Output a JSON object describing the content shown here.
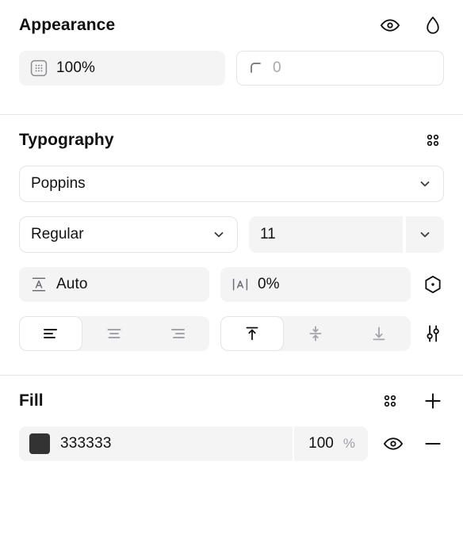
{
  "appearance": {
    "title": "Appearance",
    "header_icons": [
      {
        "name": "visibility-eye-icon",
        "label": "Toggle visibility"
      },
      {
        "name": "blend-mode-droplet-icon",
        "label": "Blend mode"
      }
    ],
    "opacity": {
      "icon": "opacity-grid-icon",
      "value": "100%"
    },
    "corner_radius": {
      "icon": "corner-radius-icon",
      "value": "0",
      "placeholder": "0"
    }
  },
  "typography": {
    "title": "Typography",
    "header_icons": [
      {
        "name": "text-styles-dots-icon",
        "label": "Text styles"
      }
    ],
    "font_family": {
      "value": "Poppins",
      "chevron": "chevron-down-icon"
    },
    "font_weight": {
      "value": "Regular",
      "chevron": "chevron-down-icon"
    },
    "font_size": {
      "value": "11",
      "chevron": "chevron-down-icon"
    },
    "line_height": {
      "icon": "line-height-icon",
      "value": "Auto"
    },
    "letter_spacing": {
      "icon": "letter-spacing-icon",
      "value": "0%"
    },
    "decoration_icon": {
      "name": "text-decoration-hexagon-icon",
      "label": "Text decoration"
    },
    "type_settings_icon": {
      "name": "type-settings-sliders-icon",
      "label": "Type settings"
    },
    "horizontal_align": {
      "options": [
        {
          "name": "align-left-icon",
          "label": "Align left",
          "active": true
        },
        {
          "name": "align-center-icon",
          "label": "Align center",
          "active": false
        },
        {
          "name": "align-right-icon",
          "label": "Align right",
          "active": false
        }
      ]
    },
    "vertical_align": {
      "options": [
        {
          "name": "align-top-icon",
          "label": "Align top",
          "active": true
        },
        {
          "name": "align-middle-icon",
          "label": "Align middle",
          "active": false
        },
        {
          "name": "align-bottom-icon",
          "label": "Align bottom",
          "active": false
        }
      ]
    }
  },
  "fill": {
    "title": "Fill",
    "header_icons": [
      {
        "name": "color-styles-dots-icon",
        "label": "Color styles"
      },
      {
        "name": "add-fill-plus-icon",
        "label": "Add fill"
      }
    ],
    "items": [
      {
        "swatch_color": "#333333",
        "hex": "333333",
        "opacity": "100",
        "opacity_unit": "%",
        "visibility_icon": "visibility-eye-icon",
        "remove_icon": "remove-fill-minus-icon"
      }
    ]
  },
  "theme": {
    "field_bg": "#f4f4f5",
    "field_border": "#e4e4e6",
    "divider": "#e8e8e8",
    "text": "#111111",
    "muted_text": "#a8a8ad",
    "surface": "#ffffff"
  }
}
